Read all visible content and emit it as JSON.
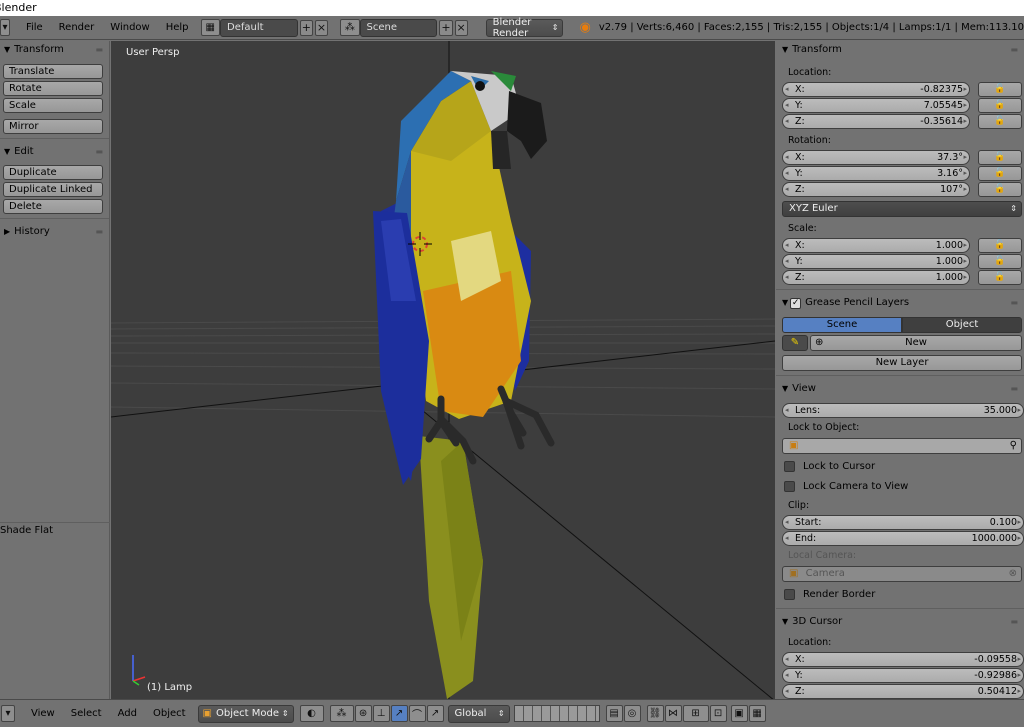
{
  "window": {
    "title": "Blender"
  },
  "topbar": {
    "menus": [
      "File",
      "Render",
      "Window",
      "Help"
    ],
    "layout": "Default",
    "scene": "Scene",
    "engine": "Blender Render",
    "stats": "v2.79 | Verts:6,460 | Faces:2,155 | Tris:2,155 | Objects:1/4 | Lamps:1/1 | Mem:113.10"
  },
  "toolshelf": {
    "transform": {
      "title": "Transform",
      "buttons": [
        "Translate",
        "Rotate",
        "Scale",
        "Mirror"
      ]
    },
    "edit": {
      "title": "Edit",
      "buttons": [
        "Duplicate",
        "Duplicate Linked",
        "Delete"
      ]
    },
    "history": {
      "title": "History"
    },
    "shade_label": "Shade Flat"
  },
  "viewport": {
    "view_label": "User Persp",
    "object_label": "(1) Lamp"
  },
  "props": {
    "transform": {
      "title": "Transform",
      "location_label": "Location:",
      "location": {
        "x": "-0.82375",
        "y": "7.05545",
        "z": "-0.35614"
      },
      "rotation_label": "Rotation:",
      "rotation": {
        "x": "37.3°",
        "y": "3.16°",
        "z": "107°"
      },
      "rotation_mode": "XYZ Euler",
      "scale_label": "Scale:",
      "scale": {
        "x": "1.000",
        "y": "1.000",
        "z": "1.000"
      }
    },
    "grease": {
      "title": "Grease Pencil Layers",
      "tabs": [
        "Scene",
        "Object"
      ],
      "new_label": "New",
      "new_layer_label": "New Layer"
    },
    "view": {
      "title": "View",
      "lens_label": "Lens:",
      "lens_value": "35.000",
      "lock_object_label": "Lock to Object:",
      "lock_cursor": "Lock to Cursor",
      "lock_camera": "Lock Camera to View",
      "clip_label": "Clip:",
      "start_label": "Start:",
      "start_value": "0.100",
      "end_label": "End:",
      "end_value": "1000.000",
      "local_camera_label": "Local Camera:",
      "camera_value": "Camera",
      "render_border": "Render Border"
    },
    "cursor": {
      "title": "3D Cursor",
      "location_label": "Location:",
      "x": "-0.09558",
      "y": "-0.92986",
      "z": "0.50412"
    },
    "axis": {
      "x": "X:",
      "y": "Y:",
      "z": "Z:"
    }
  },
  "bottombar": {
    "menus": [
      "View",
      "Select",
      "Add",
      "Object"
    ],
    "mode": "Object Mode",
    "orientation": "Global"
  },
  "colors": {
    "accent": "#5680c2",
    "viewport_bg": "#3d3d3d",
    "panel_bg": "#727272"
  }
}
